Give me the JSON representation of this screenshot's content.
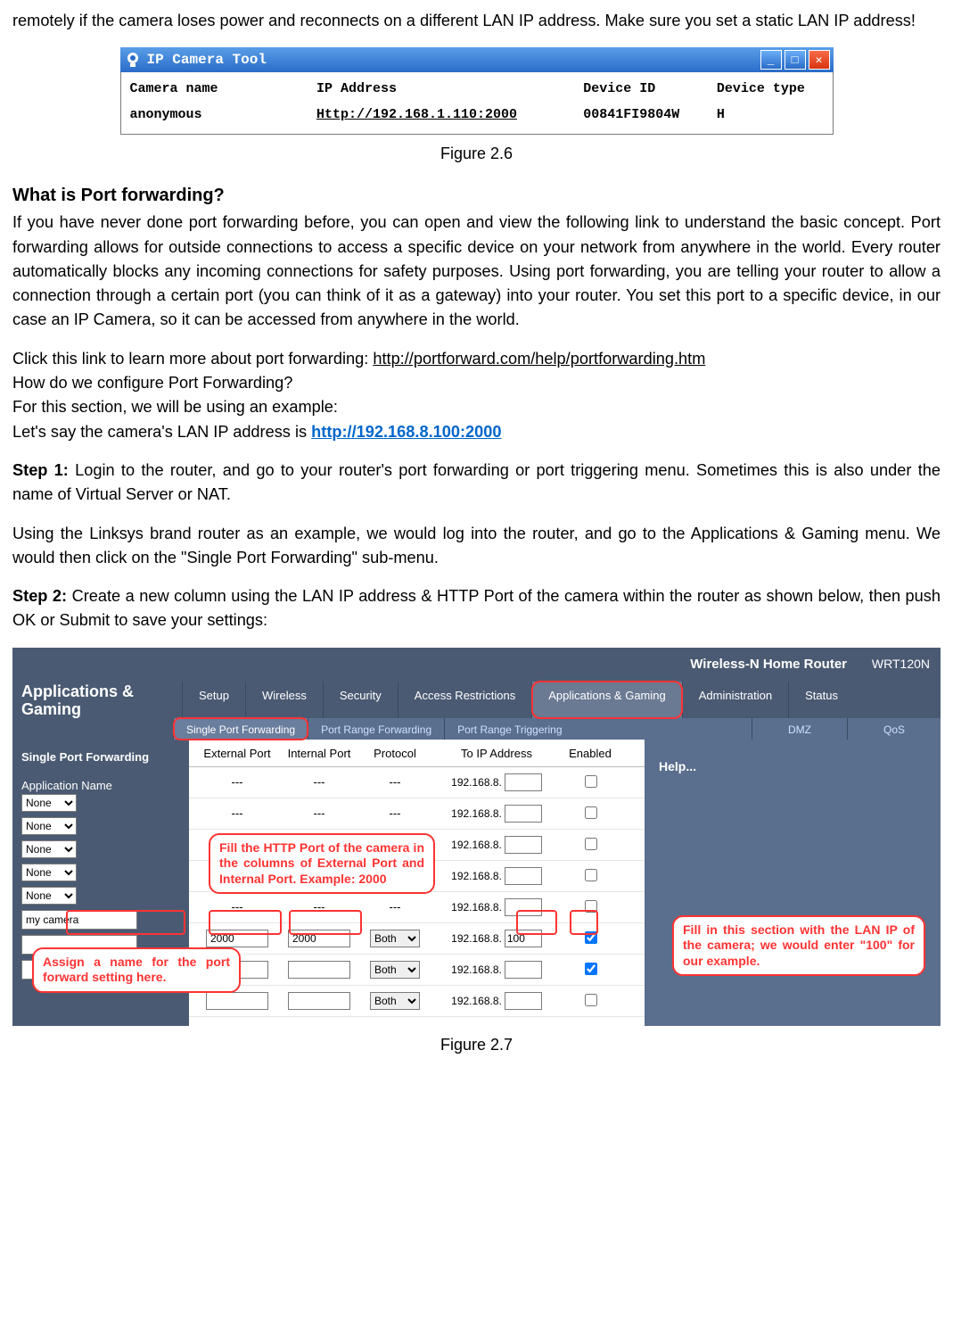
{
  "intro": {
    "line": "remotely if the camera loses power and reconnects on a different LAN IP address. Make sure you set a static LAN IP address!"
  },
  "iptool": {
    "title": "IP Camera Tool",
    "headers": {
      "c1": "Camera name",
      "c2": "IP Address",
      "c3": "Device ID",
      "c4": "Device type"
    },
    "row": {
      "c1": "anonymous",
      "c2": "Http://192.168.1.110:2000",
      "c3": "00841FI9804W",
      "c4": "H"
    }
  },
  "fig26": "Figure 2.6",
  "heading": "What is Port forwarding?",
  "para1": "If you have never done port forwarding before, you can open and view the following link to understand the basic concept. Port forwarding allows for outside connections to access a specific device on your network from anywhere in the world. Every router automatically blocks any incoming connections for safety purposes. Using port forwarding, you are telling your router to allow a connection through a certain port (you can think of it as a gateway) into your router. You set this port to a specific device, in our case an IP Camera, so it can be accessed from anywhere in the world.",
  "linkline_pre": "Click this link to learn more about port forwarding: ",
  "linkline_url": "http://portforward.com/help/portforwarding.htm",
  "cfg_q": "How do we configure Port Forwarding?",
  "cfg_ex": "For this section, we will be using an example:",
  "cfg_ip_pre": "Let's say the camera's LAN IP address is ",
  "cfg_ip": "http://192.168.8.100:2000",
  "step1_label": "Step 1:",
  "step1_text": " Login to the router, and go to your router's port forwarding or port triggering menu. Sometimes this is also under the name of Virtual Server or NAT.",
  "linksys": "Using the Linksys brand router as an example, we would log into the router, and go to the Applications & Gaming menu. We would then click on the \"Single Port Forwarding\" sub-menu.",
  "step2_label": "Step 2:",
  "step2_text": " Create a new column using the LAN IP address & HTTP Port of the camera within the router as shown below, then push OK or Submit to save your settings:",
  "router": {
    "brand": "Wireless-N Home Router",
    "model": "WRT120N",
    "section": "Applications & Gaming",
    "nav": [
      "Setup",
      "Wireless",
      "Security",
      "Access Restrictions",
      "Applications & Gaming",
      "Administration",
      "Status"
    ],
    "subnav": {
      "spf": "Single Port Forwarding",
      "prf": "Port Range Forwarding",
      "prt": "Port Range Triggering",
      "dmz": "DMZ",
      "qos": "QoS"
    },
    "side_title": "Single Port Forwarding",
    "side_app": "Application Name",
    "cols": {
      "ext": "External Port",
      "int": "Internal Port",
      "proto": "Protocol",
      "ip": "To IP Address",
      "en": "Enabled"
    },
    "none": "None",
    "dash": "---",
    "both": "Both",
    "ip_prefix": "192.168.8.",
    "rows": [
      {
        "type": "preset"
      },
      {
        "type": "preset"
      },
      {
        "type": "preset"
      },
      {
        "type": "preset"
      },
      {
        "type": "preset"
      },
      {
        "type": "custom",
        "name": "my camera",
        "ext": "2000",
        "int": "2000",
        "proto": "Both",
        "ip": "100",
        "en": true
      },
      {
        "type": "custom",
        "name": "",
        "ext": "",
        "int": "",
        "proto": "Both",
        "ip": "",
        "en": true
      },
      {
        "type": "custom",
        "name": "",
        "ext": "",
        "int": "",
        "proto": "Both",
        "ip": "",
        "en": false
      }
    ],
    "help": "Help...",
    "callouts": {
      "ports": "Fill the HTTP Port of the camera in the columns of External Port and Internal Port. Example: 2000",
      "name": "Assign a name for the port forward setting here.",
      "ip": "Fill in this section with the LAN IP of the camera; we would enter \"100\" for our example."
    }
  },
  "fig27": "Figure 2.7"
}
